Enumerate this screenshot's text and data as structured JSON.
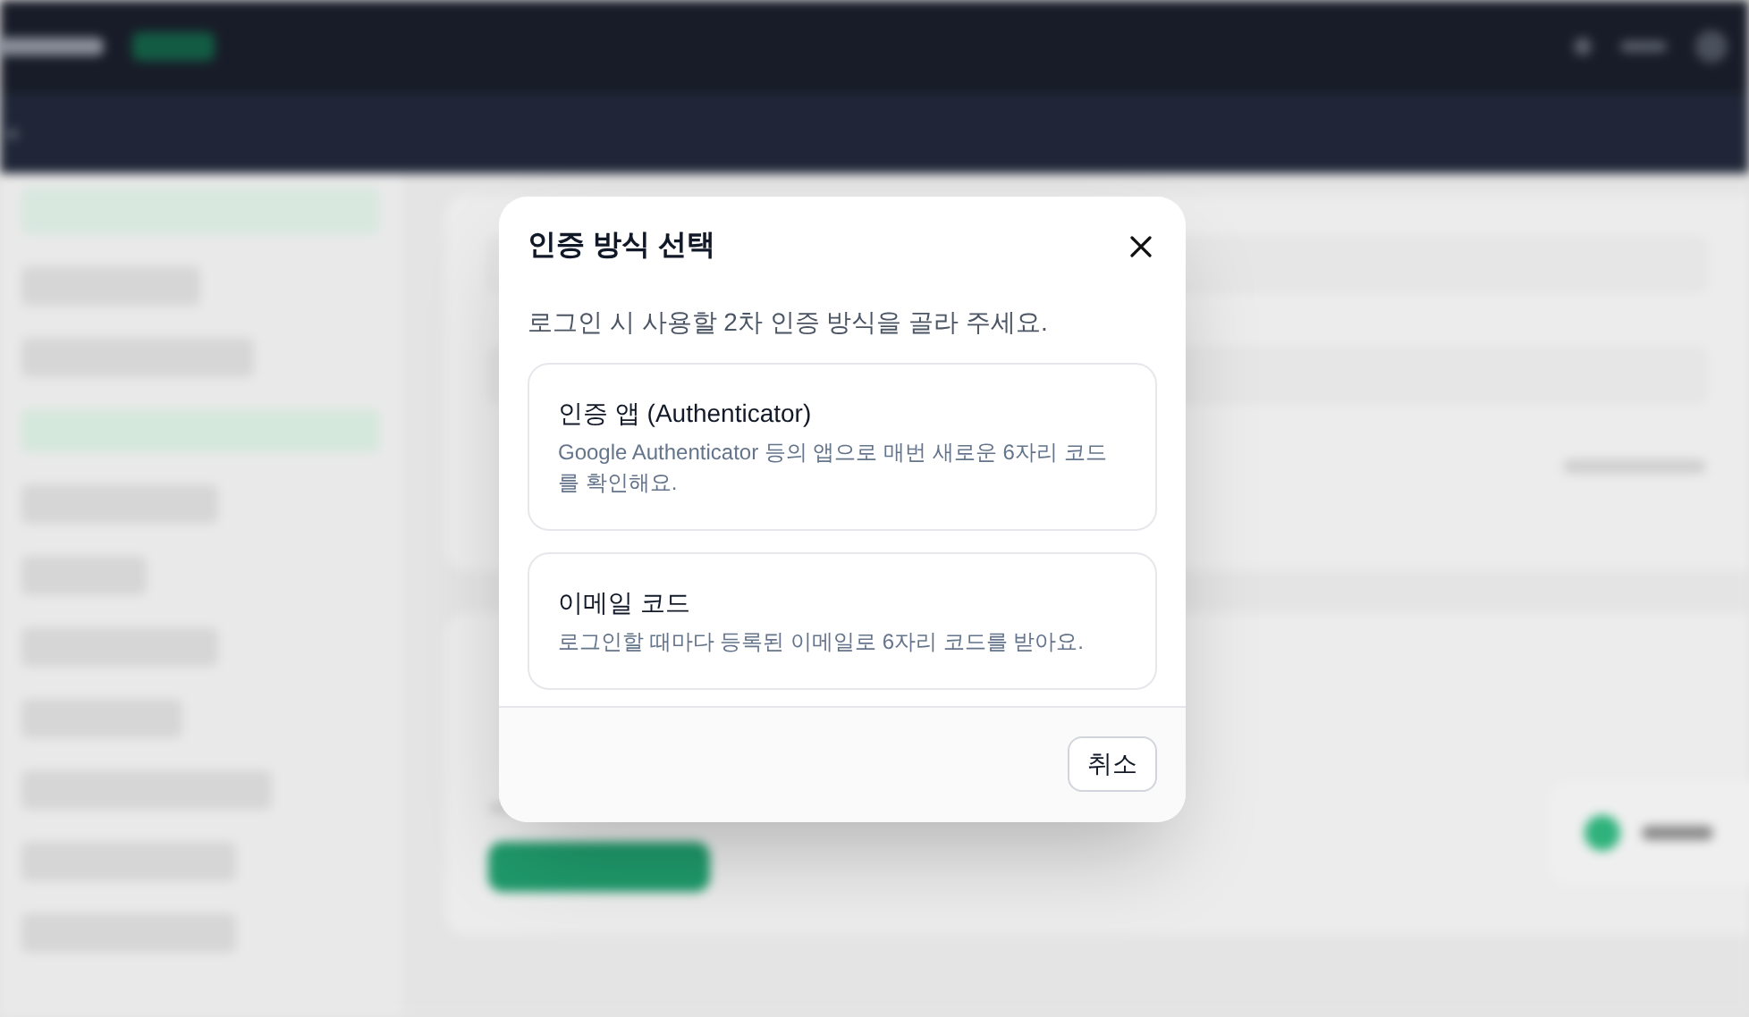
{
  "dialog": {
    "title": "인증 방식 선택",
    "description": "로그인 시 사용할 2차 인증 방식을 골라 주세요.",
    "options": [
      {
        "title": "인증 앱 (Authenticator)",
        "description": "Google Authenticator 등의 앱으로 매번 새로운 6자리 코드를 확인해요."
      },
      {
        "title": "이메일 코드",
        "description": "로그인할 때마다 등록된 이메일로 6자리 코드를 받아요."
      }
    ],
    "cancel_button": "취소"
  }
}
